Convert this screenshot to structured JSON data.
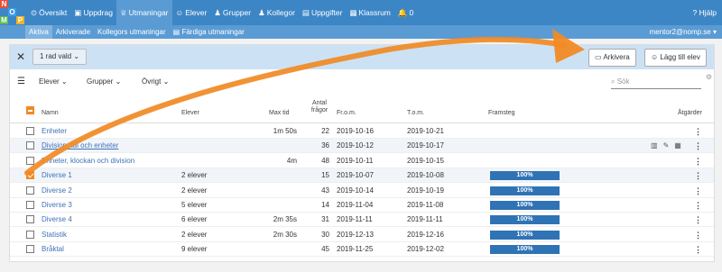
{
  "logo": {
    "letters": [
      "N",
      "O",
      "M",
      "P"
    ],
    "colors": [
      "#e94f3d",
      "#3d9be9",
      "#5bb85c",
      "#f0b323"
    ]
  },
  "nav": [
    {
      "label": "Översikt",
      "icon": "dashboard-icon",
      "glyph": "⊙",
      "active": false
    },
    {
      "label": "Uppdrag",
      "icon": "folder-icon",
      "glyph": "▣",
      "active": false
    },
    {
      "label": "Utmaningar",
      "icon": "trophy-icon",
      "glyph": "♕",
      "active": true
    },
    {
      "label": "Elever",
      "icon": "person-icon",
      "glyph": "☺",
      "active": false
    },
    {
      "label": "Grupper",
      "icon": "group-icon",
      "glyph": "♟",
      "active": false
    },
    {
      "label": "Kollegor",
      "icon": "colleagues-icon",
      "glyph": "♟",
      "active": false
    },
    {
      "label": "Uppgifter",
      "icon": "task-icon",
      "glyph": "▤",
      "active": false
    },
    {
      "label": "Klassrum",
      "icon": "classroom-icon",
      "glyph": "▦",
      "active": false
    },
    {
      "label": "0",
      "icon": "bell-icon",
      "glyph": "🔔",
      "active": false
    }
  ],
  "help_label": "Hjälp",
  "subnav": [
    {
      "label": "Aktiva",
      "active": true
    },
    {
      "label": "Arkiverade",
      "active": false
    },
    {
      "label": "Kollegors utmaningar",
      "active": false
    },
    {
      "label": "Färdiga utmaningar",
      "active": false
    }
  ],
  "user": "mentor2@nomp.se",
  "selection": {
    "label": "1 rad vald",
    "archive": "Arkivera",
    "add_student": "Lägg till elev"
  },
  "filters": {
    "students": "Elever",
    "groups": "Grupper",
    "other": "Övrigt",
    "search_placeholder": "Sök"
  },
  "headers": {
    "name": "Namn",
    "students": "Elever",
    "max_time": "Max tid",
    "questions": "Antal frågor",
    "from": "Fr.o.m.",
    "to": "T.o.m.",
    "progress": "Framsteg",
    "actions": "Åtgärder"
  },
  "rows": [
    {
      "name": "Enheter",
      "students": "",
      "max_time": "1m 50s",
      "questions": "22",
      "from": "2019-10-16",
      "to": "2019-10-21",
      "progress": "",
      "checked": false,
      "hover": false
    },
    {
      "name": "Division, tal och enheter",
      "students": "",
      "max_time": "",
      "questions": "36",
      "from": "2019-10-12",
      "to": "2019-10-17",
      "progress": "",
      "checked": false,
      "hover": true
    },
    {
      "name": "Enheter, klockan och division",
      "students": "",
      "max_time": "4m",
      "questions": "48",
      "from": "2019-10-11",
      "to": "2019-10-15",
      "progress": "",
      "checked": false,
      "hover": false
    },
    {
      "name": "Diverse 1",
      "students": "2 elever",
      "max_time": "",
      "questions": "15",
      "from": "2019-10-07",
      "to": "2019-10-08",
      "progress": "100%",
      "checked": true,
      "hover": false
    },
    {
      "name": "Diverse 2",
      "students": "2 elever",
      "max_time": "",
      "questions": "43",
      "from": "2019-10-14",
      "to": "2019-10-19",
      "progress": "100%",
      "checked": false,
      "hover": false
    },
    {
      "name": "Diverse 3",
      "students": "5 elever",
      "max_time": "",
      "questions": "14",
      "from": "2019-11-04",
      "to": "2019-11-08",
      "progress": "100%",
      "checked": false,
      "hover": false
    },
    {
      "name": "Diverse 4",
      "students": "6 elever",
      "max_time": "2m 35s",
      "questions": "31",
      "from": "2019-11-11",
      "to": "2019-11-11",
      "progress": "100%",
      "checked": false,
      "hover": false
    },
    {
      "name": "Statistik",
      "students": "2 elever",
      "max_time": "2m 30s",
      "questions": "30",
      "from": "2019-12-13",
      "to": "2019-12-16",
      "progress": "100%",
      "checked": false,
      "hover": false
    },
    {
      "name": "Bråktal",
      "students": "9 elever",
      "max_time": "",
      "questions": "45",
      "from": "2019-11-25",
      "to": "2019-12-02",
      "progress": "100%",
      "checked": false,
      "hover": false
    }
  ],
  "colors": {
    "topbar": "#3d86c6",
    "subbar": "#5a9bd4",
    "accent": "#f08a24",
    "progress": "#2f73b5",
    "selection_bar": "#cde1f5"
  }
}
